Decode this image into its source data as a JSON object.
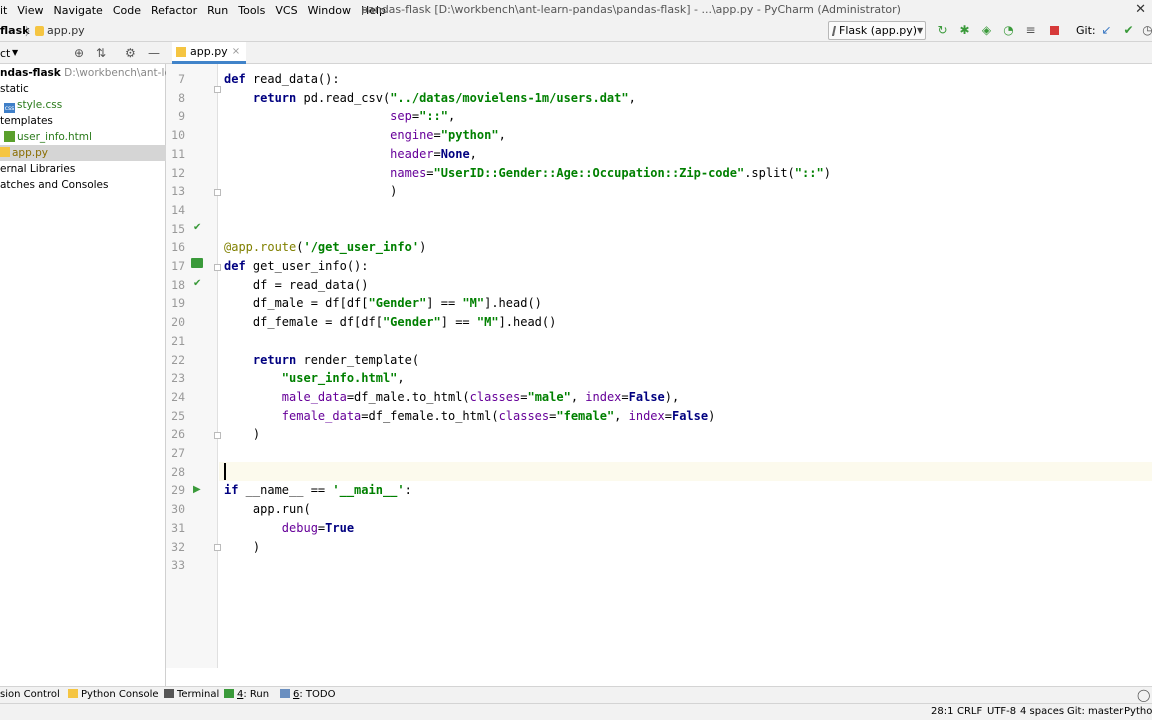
{
  "window": {
    "title": "pandas-flask [D:\\workbench\\ant-learn-pandas\\pandas-flask] - ...\\app.py - PyCharm (Administrator)",
    "close_glyph": "✕"
  },
  "menu": [
    "it",
    "View",
    "Navigate",
    "Code",
    "Refactor",
    "Run",
    "Tools",
    "VCS",
    "Window",
    "Help"
  ],
  "navbar": {
    "project": "flask",
    "separator": "〉",
    "file": "app.py",
    "run_config": "Flask (app.py)",
    "git_label": "Git:"
  },
  "project_panel": {
    "title": "ct",
    "tree": [
      {
        "label": "ndas-flask",
        "path": "D:\\workbench\\ant-learn-p"
      },
      {
        "label": "static"
      },
      {
        "label": "style.css"
      },
      {
        "label": "templates"
      },
      {
        "label": "user_info.html"
      },
      {
        "label": "app.py"
      },
      {
        "label": "ernal Libraries"
      },
      {
        "label": "atches and Consoles"
      }
    ]
  },
  "editor": {
    "tab": "app.py",
    "tab_close": "×",
    "line_numbers": [
      "7",
      "8",
      "9",
      "10",
      "11",
      "12",
      "13",
      "14",
      "15",
      "16",
      "17",
      "18",
      "19",
      "20",
      "21",
      "22",
      "23",
      "24",
      "25",
      "26",
      "27",
      "28",
      "29",
      "30",
      "31",
      "32",
      "33"
    ],
    "code": [
      "def read_data():",
      "    return pd.read_csv(\"../datas/movielens-1m/users.dat\",",
      "                       sep=\"::\",",
      "                       engine=\"python\",",
      "                       header=None,",
      "                       names=\"UserID::Gender::Age::Occupation::Zip-code\".split(\"::\")",
      "                       )",
      "",
      "",
      "@app.route('/get_user_info')",
      "def get_user_info():",
      "    df = read_data()",
      "    df_male = df[df[\"Gender\"] == \"M\"].head()",
      "    df_female = df[df[\"Gender\"] == \"M\"].head()",
      "",
      "    return render_template(",
      "        \"user_info.html\",",
      "        male_data=df_male.to_html(classes=\"male\", index=False),",
      "        female_data=df_female.to_html(classes=\"female\", index=False)",
      "    )",
      "",
      "",
      "if __name__ == '__main__':",
      "    app.run(",
      "        debug=True",
      "    )",
      ""
    ]
  },
  "tool_strip": {
    "version_control": "sion Control",
    "python_console": "Python Console",
    "terminal": "Terminal",
    "run_key": "4",
    "run": ": Run",
    "todo_key": "6",
    "todo": ": TODO"
  },
  "status": {
    "position": "28:1",
    "line_sep": "CRLF",
    "encoding": "UTF-8",
    "indent": "4 spaces",
    "git_branch": "Git: master",
    "interpreter": "Pytho"
  },
  "colors": {
    "keyword": "#000080",
    "string": "#008000",
    "param": "#660099",
    "decorator": "#808000",
    "accent": "#4083c9"
  }
}
